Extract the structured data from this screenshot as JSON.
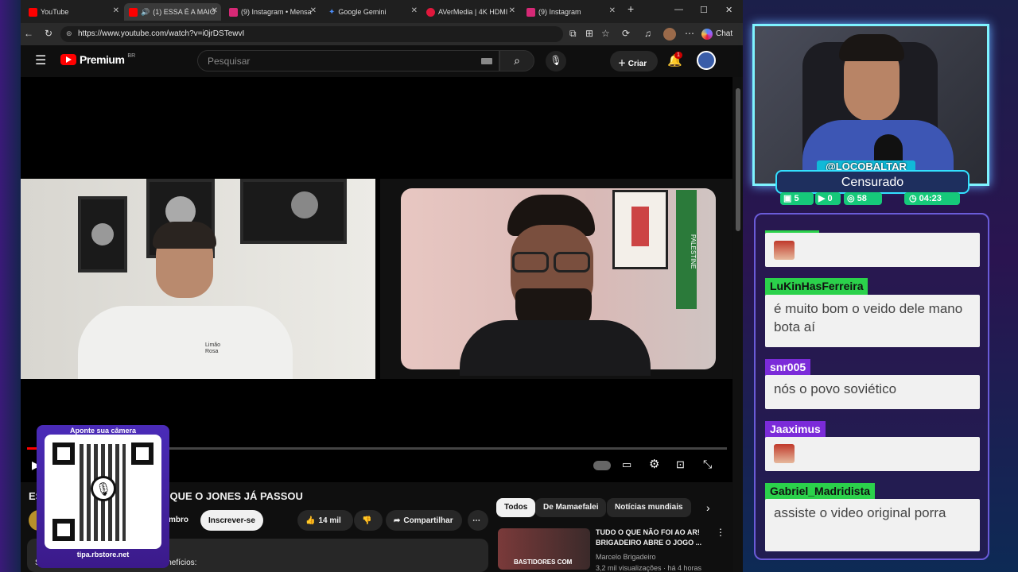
{
  "browser": {
    "tabs": [
      {
        "label": "YouTube",
        "color": "#ff0000"
      },
      {
        "label": "(1) ESSA É A MAIO",
        "color": "#ff0000"
      },
      {
        "label": "(9) Instagram • Mensa",
        "color": "#d62976"
      },
      {
        "label": "Google Gemini",
        "color": "#4b8bf5"
      },
      {
        "label": "AVerMedia | 4K HDMI",
        "color": "#e0183c"
      },
      {
        "label": "(9) Instagram",
        "color": "#d62976"
      }
    ],
    "url": "https://www.youtube.com/watch?v=i0jrDSTewvI",
    "chat_button": "Chat"
  },
  "youtube": {
    "logo_text": "Premium",
    "logo_region": "BR",
    "search_placeholder": "Pesquisar",
    "create_label": "Criar",
    "notification_count": "1",
    "video_title_start": "ES",
    "video_title_end": "A QUE O JONES JÁ PASSOU",
    "join_label": "mbro",
    "subscribe_label": "Inscrever-se",
    "likes": "14 mil",
    "share_label": "Compartilhar",
    "member_text": "Seja membro deste canal e ganhe benefícios:",
    "chips": [
      "Todos",
      "De Mamaefalei",
      "Notícias mundiais"
    ],
    "recommendation": {
      "title_line1": "TUDO O QUE NÃO FOI AO AR!",
      "title_line2": "BRIGADEIRO ABRE O JOGO ...",
      "channel": "Marcelo Brigadeiro",
      "meta": "3,2 mil visualizações · há 4 horas",
      "thumb_text": "BASTIDORES COM"
    },
    "video_shirt_text": "Limão Rosa",
    "poster_text": "PALESTINE"
  },
  "stream": {
    "handle": "@LOCOBALTAR",
    "status": "Censurado",
    "stats": {
      "chat": "5",
      "youtube": "0",
      "viewers": "58",
      "time": "04:23"
    }
  },
  "chat": {
    "messages": [
      {
        "user": "",
        "text": ""
      },
      {
        "user": "LuKinHasFerreira",
        "text": "é muito bom o veido dele mano bota aí"
      },
      {
        "user": "snr005",
        "text": "nós o povo soviético"
      },
      {
        "user": "Jaaximus",
        "text": ""
      },
      {
        "user": "Gabriel_Madridista",
        "text": "assiste o video original porra"
      }
    ]
  },
  "qr": {
    "heading": "Aponte sua câmera",
    "url": "tipa.rbstore.net"
  }
}
